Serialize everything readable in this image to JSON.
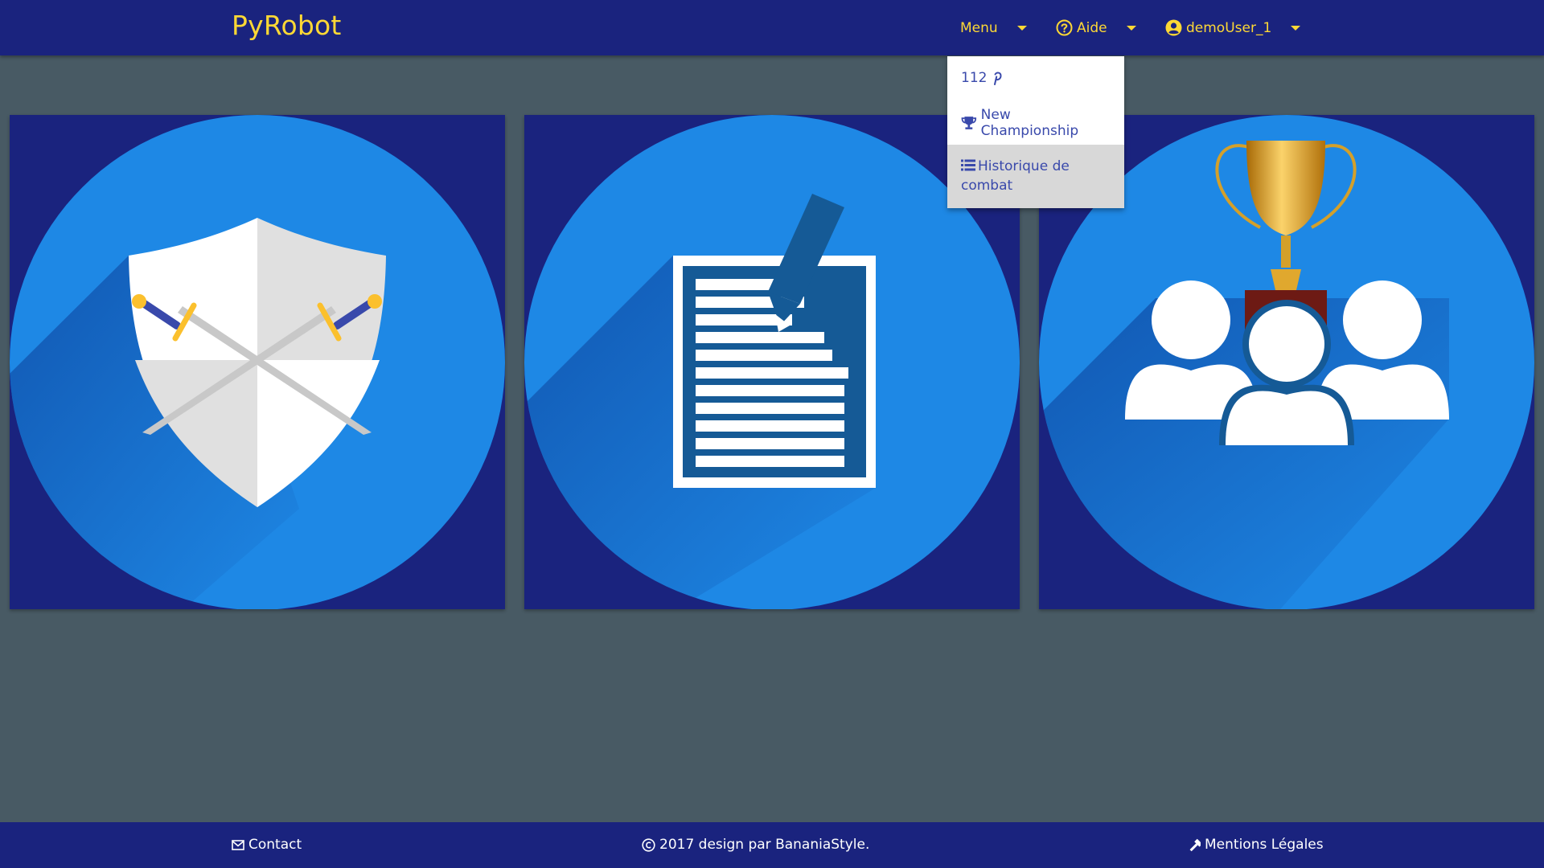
{
  "header": {
    "brand": "PyRobot",
    "menu_label": "Menu",
    "help_label": "Aide",
    "user_label": "demoUser_1"
  },
  "dropdown": {
    "items": [
      {
        "label": "112",
        "icon": "pinterest-p-icon"
      },
      {
        "label": "New Championship",
        "icon": "trophy-icon"
      },
      {
        "label": "Historique de combat",
        "icon": "list-icon",
        "active": true
      }
    ]
  },
  "cards": [
    {
      "icon": "crossed-swords-shield-icon"
    },
    {
      "icon": "document-edit-icon"
    },
    {
      "icon": "trophy-users-icon"
    }
  ],
  "footer": {
    "contact": "Contact",
    "copyright": "2017 design par BananiaStyle.",
    "legal": "Mentions Légales"
  },
  "colors": {
    "navbar": "#1a237e",
    "brand": "#fdd835",
    "page_background": "#485a64",
    "circle": "#1e88e5",
    "link": "#3949ab"
  }
}
